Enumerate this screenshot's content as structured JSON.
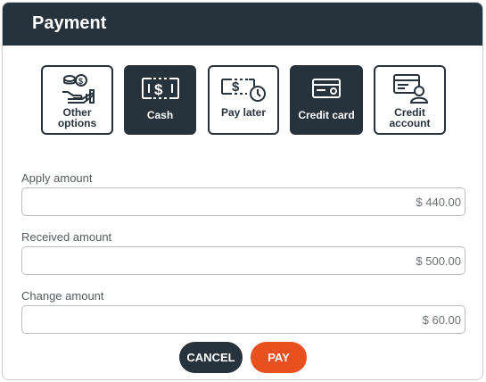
{
  "header": {
    "title": "Payment"
  },
  "methods": [
    {
      "label": "Other options",
      "icon": "coins-hand-icon",
      "selected": false
    },
    {
      "label": "Cash",
      "icon": "cash-bill-icon",
      "selected": true
    },
    {
      "label": "Pay later",
      "icon": "bill-clock-icon",
      "selected": false
    },
    {
      "label": "Credit card",
      "icon": "credit-card-icon",
      "selected": true
    },
    {
      "label": "Credit account",
      "icon": "card-person-icon",
      "selected": false
    }
  ],
  "fields": {
    "apply": {
      "label": "Apply amount",
      "value": "$ 440.00"
    },
    "received": {
      "label": "Received amount",
      "value": "$ 500.00"
    },
    "change": {
      "label": "Change amount",
      "value": "$ 60.00"
    }
  },
  "actions": {
    "cancel": "CANCEL",
    "pay": "PAY"
  },
  "colors": {
    "header": "#26323c",
    "accent": "#e8501f",
    "selected_method": "#26323c"
  }
}
